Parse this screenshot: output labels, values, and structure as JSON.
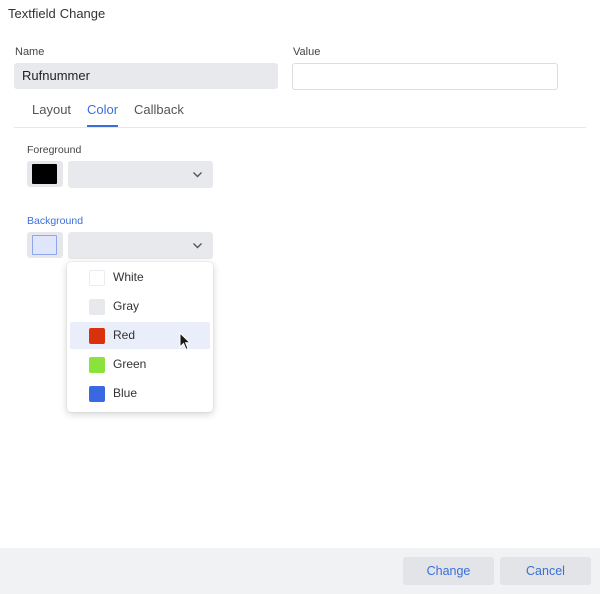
{
  "dialog": {
    "title_part1": "Textfield",
    "title_part2": "Change"
  },
  "name_field": {
    "label": "Name",
    "value": "Rufnummer"
  },
  "value_field": {
    "label": "Value",
    "value": ""
  },
  "tabs": [
    {
      "label": "Layout",
      "active": false
    },
    {
      "label": "Color",
      "active": true
    },
    {
      "label": "Callback",
      "active": false
    }
  ],
  "foreground": {
    "label": "Foreground",
    "swatch_color": "#000000",
    "selected": ""
  },
  "background": {
    "label": "Background",
    "swatch_color": "#dfe5fb",
    "selected": ""
  },
  "color_options": [
    {
      "label": "White",
      "color": "#ffffff"
    },
    {
      "label": "Gray",
      "color": "#e8e9ec"
    },
    {
      "label": "Red",
      "color": "#d9310b"
    },
    {
      "label": "Green",
      "color": "#8be23c"
    },
    {
      "label": "Blue",
      "color": "#3c67e3"
    }
  ],
  "hovered_option": "Red",
  "footer": {
    "change_label": "Change",
    "cancel_label": "Cancel"
  },
  "colors": {
    "accent": "#3a6fd8"
  }
}
